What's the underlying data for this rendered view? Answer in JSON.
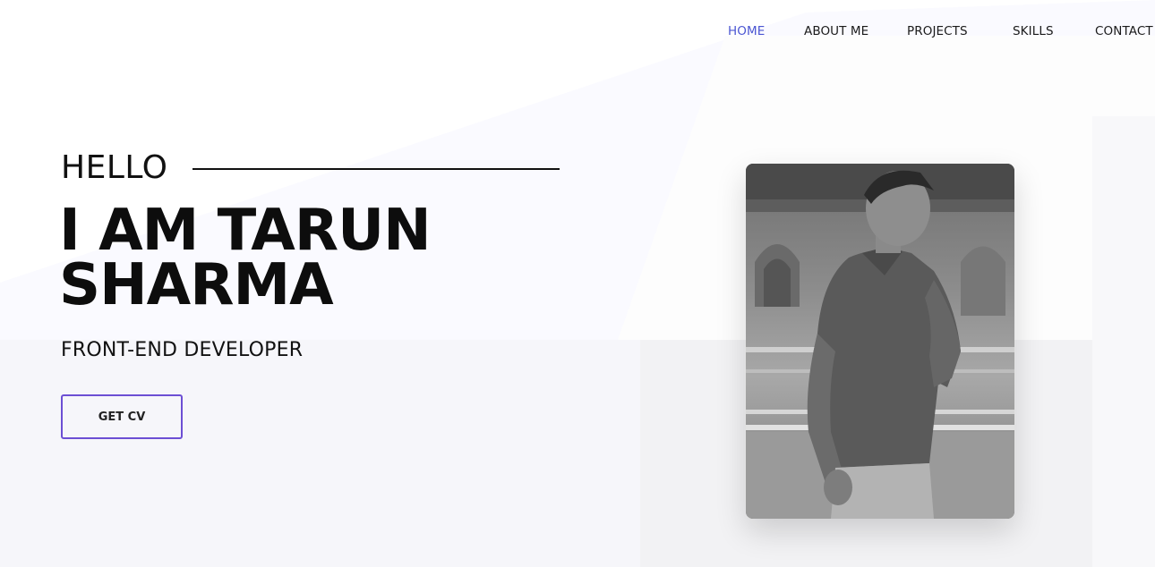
{
  "nav": {
    "items": [
      {
        "label": "HOME",
        "active": true
      },
      {
        "label": "ABOUT ME",
        "active": false
      },
      {
        "label": "PROJECTS",
        "active": false
      },
      {
        "label": "SKILLS",
        "active": false
      },
      {
        "label": "CONTACT",
        "active": false
      }
    ]
  },
  "hero": {
    "greeting": "HELLO",
    "name_line1": "I AM TARUN",
    "name_line2": "SHARMA",
    "role": "FRONT-END DEVELOPER",
    "cta_label": "GET CV"
  },
  "colors": {
    "accent": "#4b56d2",
    "button_border": "#6c4fd4",
    "text": "#111111",
    "background": "#ffffff",
    "panel_tint": "#f6f6fb"
  },
  "icons": {
    "photo": "profile-photo"
  }
}
